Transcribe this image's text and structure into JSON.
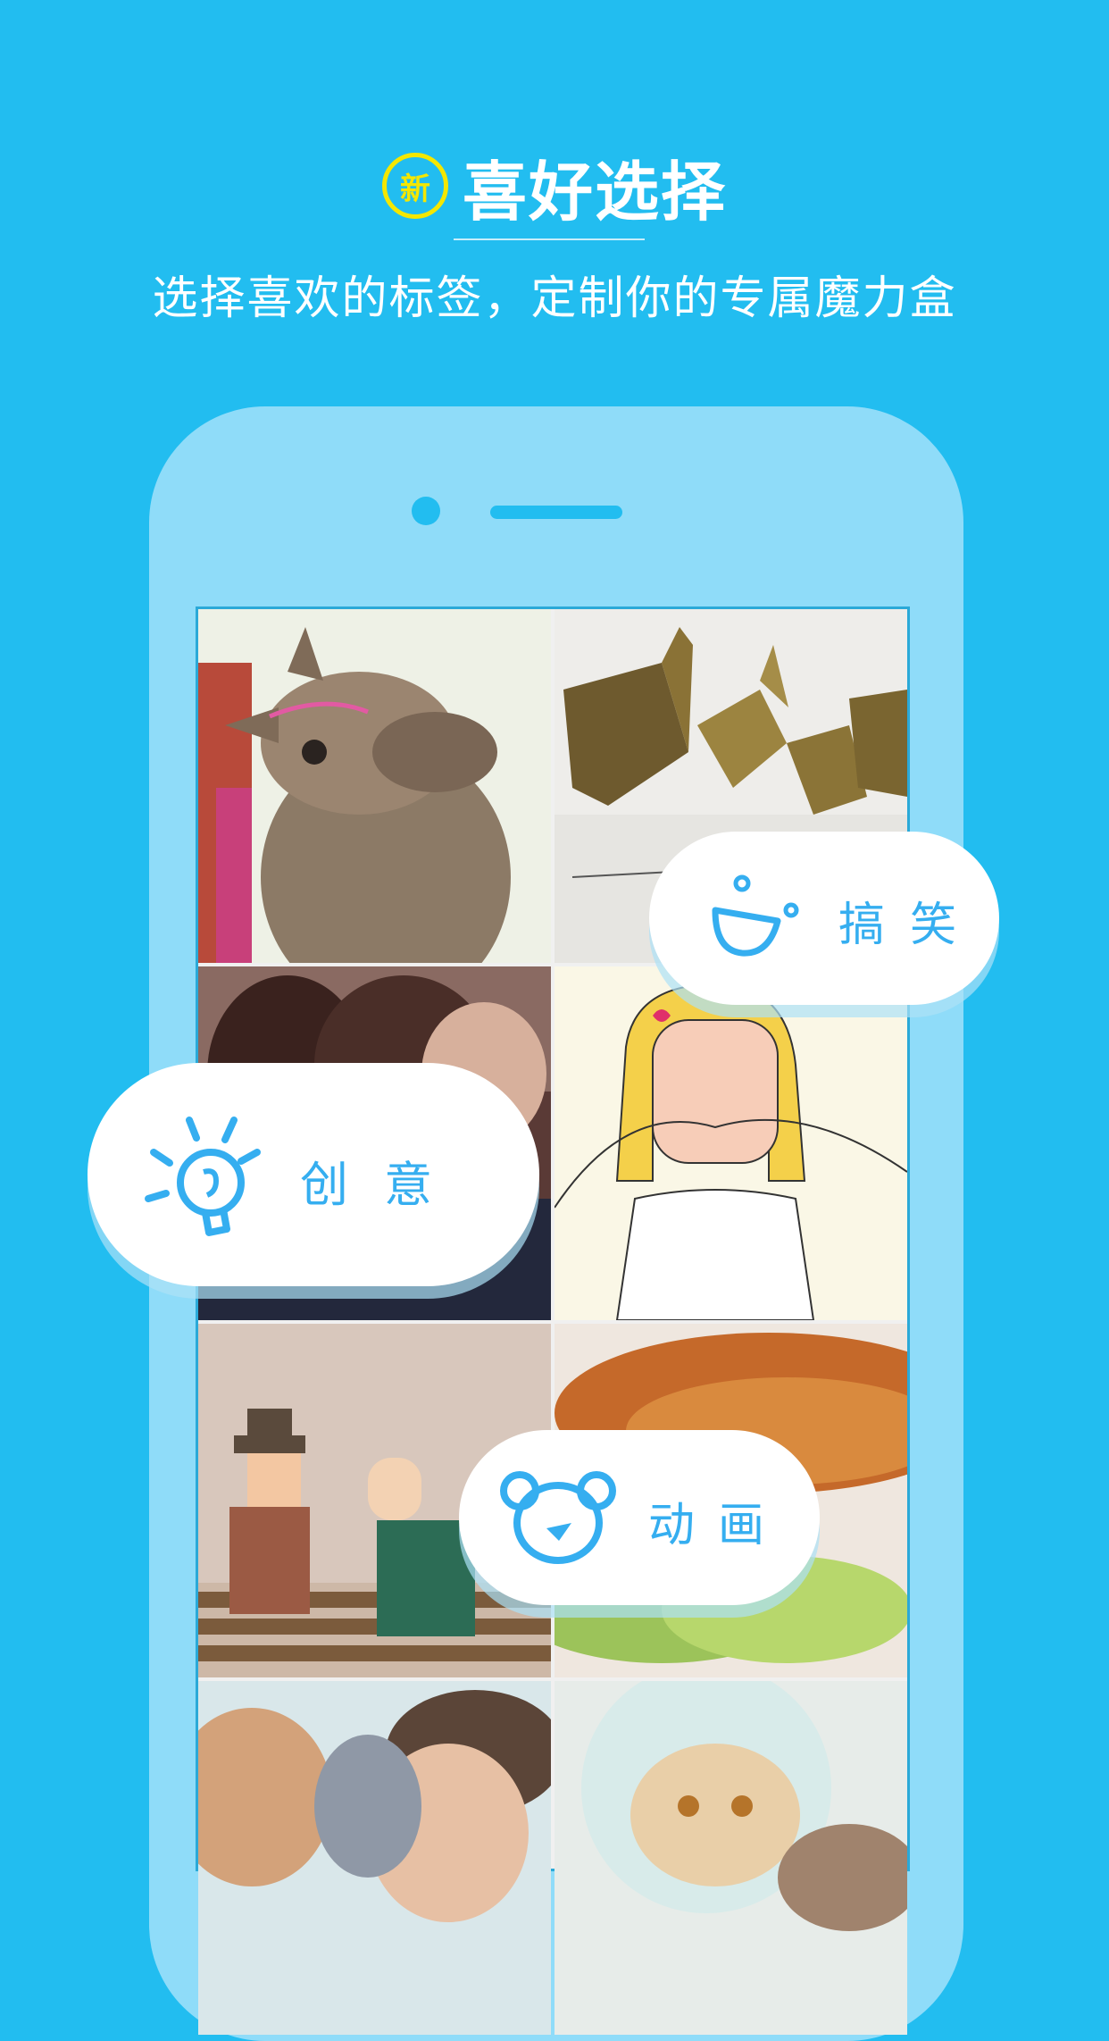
{
  "header": {
    "badge": "新",
    "title": "喜好选择",
    "subtitle": "选择喜欢的标签，定制你的专属魔力盒"
  },
  "tags": {
    "funny": {
      "label": "搞笑",
      "icon": "laughing-face-icon"
    },
    "creative": {
      "label": "创意",
      "icon": "lightbulb-icon"
    },
    "animation": {
      "label": "动画",
      "icon": "bear-face-icon"
    }
  },
  "tiles": [
    {
      "name": "llama-photo"
    },
    {
      "name": "origami-cranes-photo"
    },
    {
      "name": "couple-photo"
    },
    {
      "name": "cartoon-girl-illustration"
    },
    {
      "name": "cartoon-fight-illustration"
    },
    {
      "name": "fried-food-photo"
    },
    {
      "name": "kiss-shark-collage"
    },
    {
      "name": "persian-cat-photo"
    }
  ],
  "colors": {
    "background": "#22bdf0",
    "phone": "#8fdcf9",
    "accent": "#35aef0",
    "badge": "#f4e700"
  }
}
